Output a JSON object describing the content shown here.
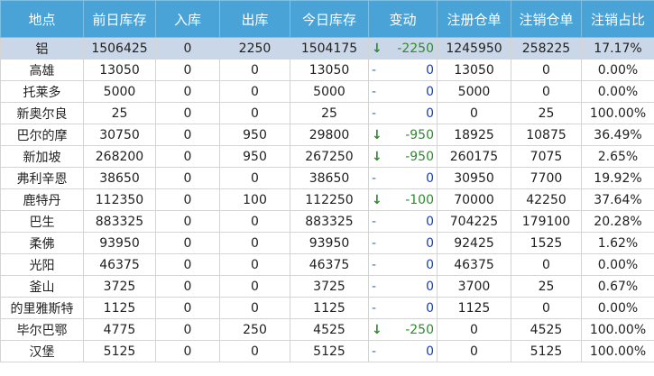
{
  "headers": [
    "地点",
    "前日库存",
    "入库",
    "出库",
    "今日库存",
    "变动",
    "注册仓单",
    "注销仓单",
    "注销占比"
  ],
  "colors": {
    "header_bg": "#4aa3d6",
    "highlight_row": "#c9d7e8",
    "down_arrow": "#2e8b2e",
    "flat_dash": "#3a6fc4"
  },
  "rows": [
    {
      "location": "铝",
      "prev": "1506425",
      "in": "0",
      "out": "2250",
      "today": "1504175",
      "indicator": "↓",
      "change": "-2250",
      "registered": "1245950",
      "cancelled": "258225",
      "ratio": "17.17%",
      "highlight": true
    },
    {
      "location": "高雄",
      "prev": "13050",
      "in": "0",
      "out": "0",
      "today": "13050",
      "indicator": "-",
      "change": "0",
      "registered": "13050",
      "cancelled": "0",
      "ratio": "0.00%"
    },
    {
      "location": "托莱多",
      "prev": "5000",
      "in": "0",
      "out": "0",
      "today": "5000",
      "indicator": "-",
      "change": "0",
      "registered": "5000",
      "cancelled": "0",
      "ratio": "0.00%"
    },
    {
      "location": "新奥尔良",
      "prev": "25",
      "in": "0",
      "out": "0",
      "today": "25",
      "indicator": "-",
      "change": "0",
      "registered": "0",
      "cancelled": "25",
      "ratio": "100.00%"
    },
    {
      "location": "巴尔的摩",
      "prev": "30750",
      "in": "0",
      "out": "950",
      "today": "29800",
      "indicator": "↓",
      "change": "-950",
      "registered": "18925",
      "cancelled": "10875",
      "ratio": "36.49%"
    },
    {
      "location": "新加坡",
      "prev": "268200",
      "in": "0",
      "out": "950",
      "today": "267250",
      "indicator": "↓",
      "change": "-950",
      "registered": "260175",
      "cancelled": "7075",
      "ratio": "2.65%"
    },
    {
      "location": "弗利辛恩",
      "prev": "38650",
      "in": "0",
      "out": "0",
      "today": "38650",
      "indicator": "-",
      "change": "0",
      "registered": "30950",
      "cancelled": "7700",
      "ratio": "19.92%"
    },
    {
      "location": "鹿特丹",
      "prev": "112350",
      "in": "0",
      "out": "100",
      "today": "112250",
      "indicator": "↓",
      "change": "-100",
      "registered": "70000",
      "cancelled": "42250",
      "ratio": "37.64%"
    },
    {
      "location": "巴生",
      "prev": "883325",
      "in": "0",
      "out": "0",
      "today": "883325",
      "indicator": "-",
      "change": "0",
      "registered": "704225",
      "cancelled": "179100",
      "ratio": "20.28%"
    },
    {
      "location": "柔佛",
      "prev": "93950",
      "in": "0",
      "out": "0",
      "today": "93950",
      "indicator": "-",
      "change": "0",
      "registered": "92425",
      "cancelled": "1525",
      "ratio": "1.62%"
    },
    {
      "location": "光阳",
      "prev": "46375",
      "in": "0",
      "out": "0",
      "today": "46375",
      "indicator": "-",
      "change": "0",
      "registered": "46375",
      "cancelled": "0",
      "ratio": "0.00%"
    },
    {
      "location": "釜山",
      "prev": "3725",
      "in": "0",
      "out": "0",
      "today": "3725",
      "indicator": "-",
      "change": "0",
      "registered": "3700",
      "cancelled": "25",
      "ratio": "0.67%"
    },
    {
      "location": "的里雅斯特",
      "prev": "1125",
      "in": "0",
      "out": "0",
      "today": "1125",
      "indicator": "-",
      "change": "0",
      "registered": "1125",
      "cancelled": "0",
      "ratio": "0.00%"
    },
    {
      "location": "毕尔巴鄂",
      "prev": "4775",
      "in": "0",
      "out": "250",
      "today": "4525",
      "indicator": "↓",
      "change": "-250",
      "registered": "0",
      "cancelled": "4525",
      "ratio": "100.00%"
    },
    {
      "location": "汉堡",
      "prev": "5125",
      "in": "0",
      "out": "0",
      "today": "5125",
      "indicator": "-",
      "change": "0",
      "registered": "0",
      "cancelled": "5125",
      "ratio": "100.00%"
    }
  ]
}
